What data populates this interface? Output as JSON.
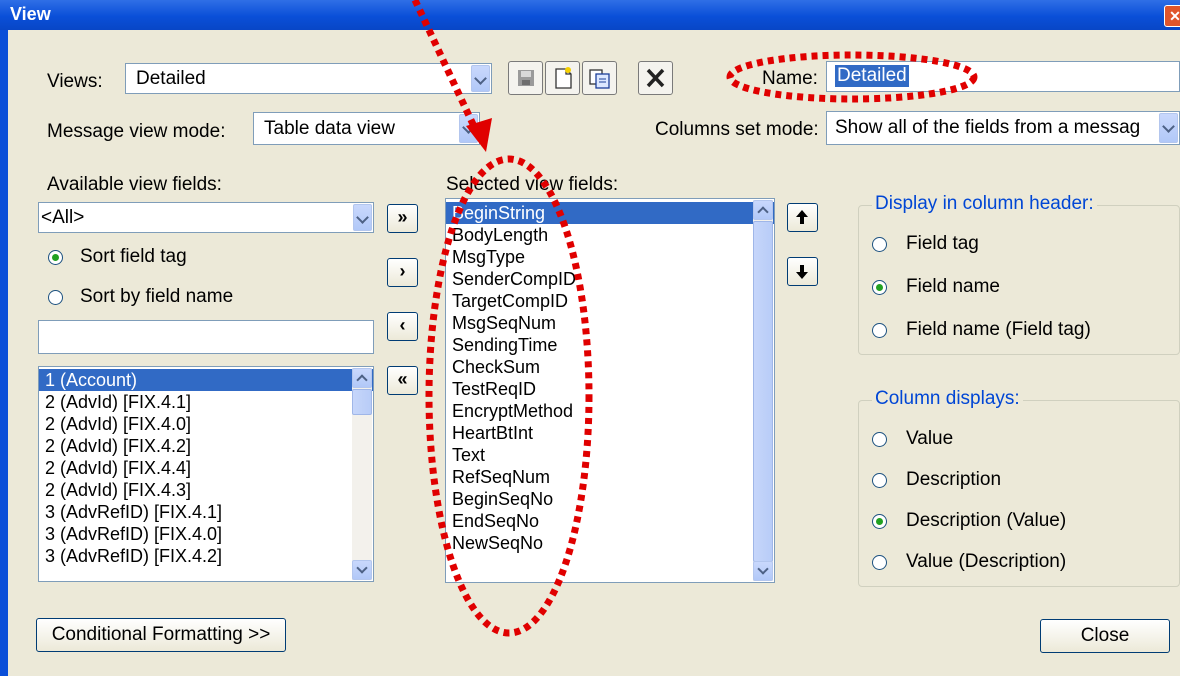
{
  "window": {
    "title": "View"
  },
  "views": {
    "label": "Views:",
    "value": "Detailed"
  },
  "name": {
    "label": "Name:",
    "value": "Detailed"
  },
  "message_view_mode": {
    "label": "Message view mode:",
    "value": "Table data view"
  },
  "columns_set_mode": {
    "label": "Columns set mode:",
    "value": "Show all of the fields from a messag"
  },
  "available": {
    "label": "Available view fields:",
    "filter_value": "<All>",
    "sort_tag_label": "Sort field tag",
    "sort_name_label": "Sort by field name",
    "sort_tag_selected": true,
    "search_value": "",
    "items": [
      "1 (Account)",
      "2 (AdvId) [FIX.4.1]",
      "2 (AdvId) [FIX.4.0]",
      "2 (AdvId) [FIX.4.2]",
      "2 (AdvId) [FIX.4.4]",
      "2 (AdvId) [FIX.4.3]",
      "3 (AdvRefID) [FIX.4.1]",
      "3 (AdvRefID) [FIX.4.0]",
      "3 (AdvRefID) [FIX.4.2]"
    ]
  },
  "transfer_buttons": {
    "add_all": "»",
    "add": "›",
    "remove": "‹",
    "remove_all": "«"
  },
  "selected": {
    "label": "Selected view fields:",
    "items": [
      "BeginString",
      "BodyLength",
      "MsgType",
      "SenderCompID",
      "TargetCompID",
      "MsgSeqNum",
      "SendingTime",
      "CheckSum",
      "TestReqID",
      "EncryptMethod",
      "HeartBtInt",
      "Text",
      "RefSeqNum",
      "BeginSeqNo",
      "EndSeqNo",
      "NewSeqNo"
    ]
  },
  "column_header": {
    "legend": "Display in column header:",
    "options": [
      "Field tag",
      "Field name",
      "Field name (Field tag)"
    ],
    "selected_index": 1
  },
  "column_displays": {
    "legend": "Column displays:",
    "options": [
      "Value",
      "Description",
      "Description (Value)",
      "Value (Description)"
    ],
    "selected_index": 2
  },
  "buttons": {
    "conditional_formatting": "Conditional Formatting >>",
    "close": "Close"
  },
  "colors": {
    "titlebar": "#0a4fd8",
    "selection": "#316ac5",
    "annotation": "#e00000",
    "group_legend": "#0046d5"
  }
}
